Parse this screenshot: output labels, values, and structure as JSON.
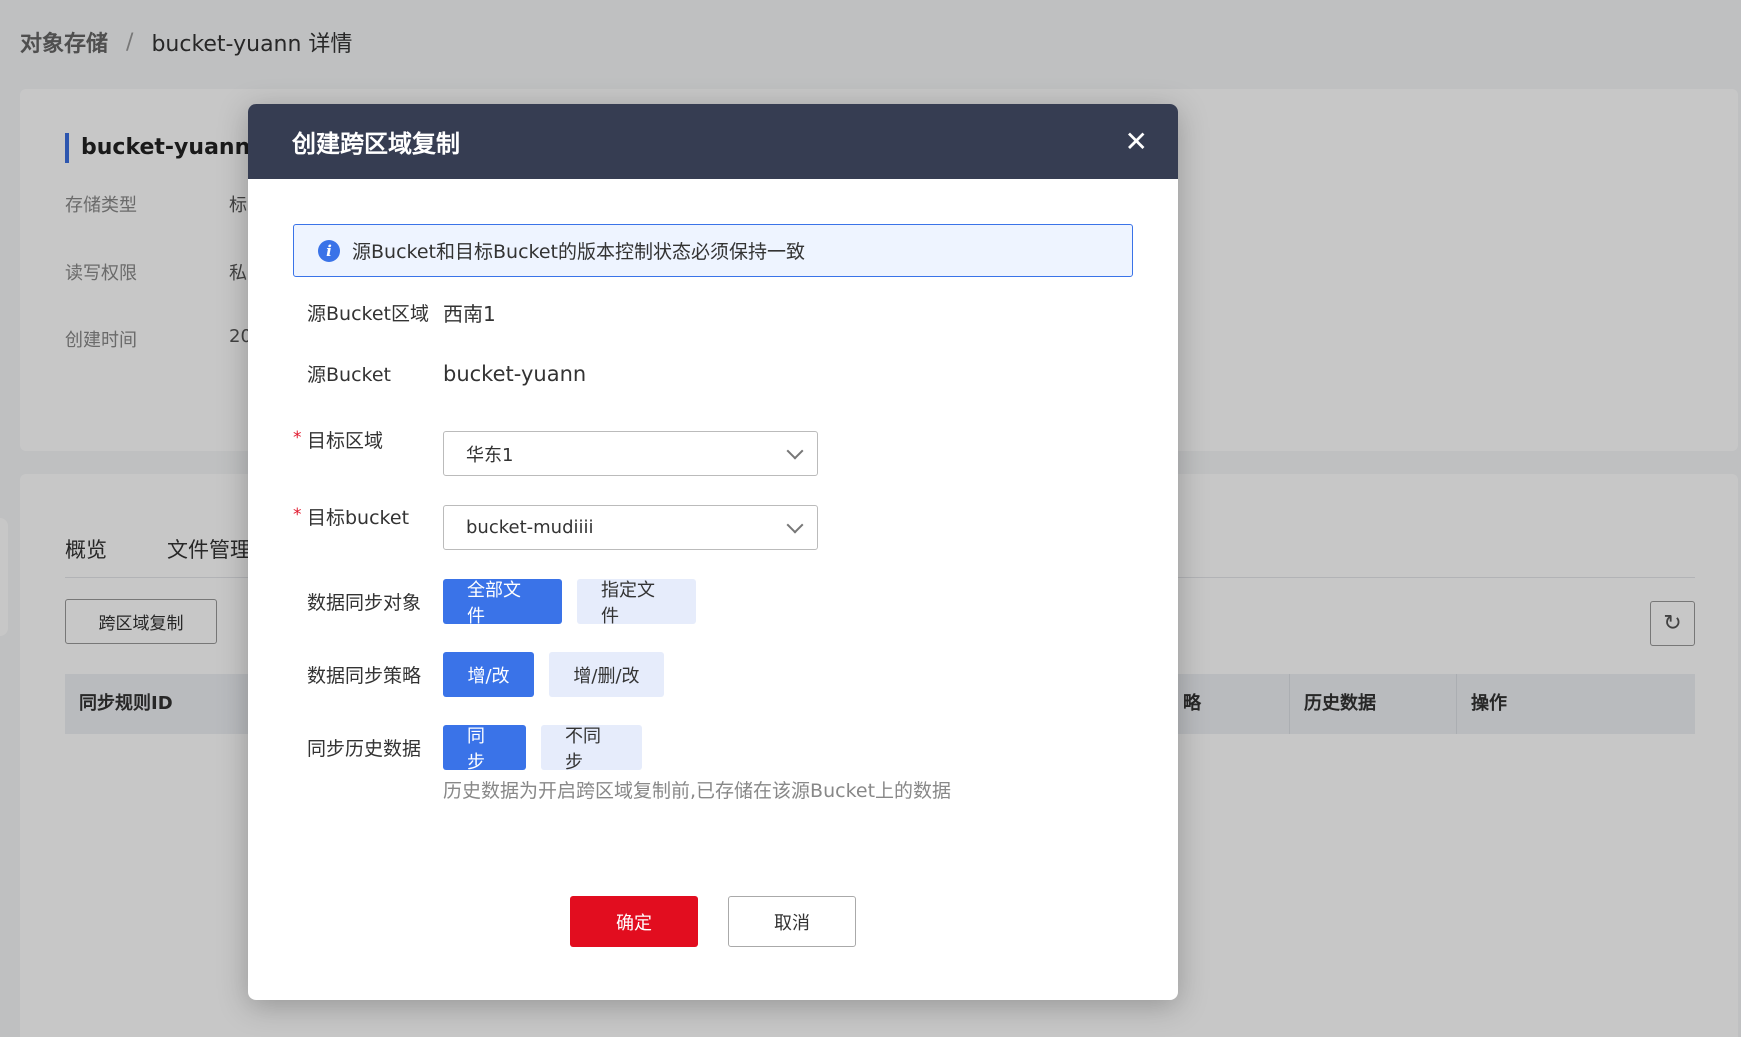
{
  "breadcrumb": {
    "root": "对象存储",
    "separator": "/",
    "current": "bucket-yuann 详情"
  },
  "info": {
    "title": "bucket-yuann详情",
    "rows": [
      {
        "label": "存储类型",
        "value": "标"
      },
      {
        "label": "读写权限",
        "value": "私"
      },
      {
        "label": "创建时间",
        "value": "20"
      }
    ]
  },
  "tabs": [
    "概览",
    "文件管理"
  ],
  "toolbar": {
    "cross_region_button": "跨区域复制",
    "refresh_icon": "refresh-icon"
  },
  "table": {
    "headers": [
      "同步规则ID",
      "略",
      "历史数据",
      "操作"
    ]
  },
  "modal": {
    "title": "创建跨区域复制",
    "close_icon": "close-icon",
    "alert": "源Bucket和目标Bucket的版本控制状态必须保持一致",
    "fields": {
      "source_region": {
        "label": "源Bucket区域",
        "value": "西南1"
      },
      "source_bucket": {
        "label": "源Bucket",
        "value": "bucket-yuann"
      },
      "target_region": {
        "label": "目标区域",
        "value": "华东1",
        "required": true
      },
      "target_bucket": {
        "label": "目标bucket",
        "value": "bucket-mudiiii",
        "required": true
      },
      "sync_object": {
        "label": "数据同步对象",
        "options": [
          "全部文件",
          "指定文件"
        ],
        "selected": "全部文件"
      },
      "sync_policy": {
        "label": "数据同步策略",
        "options": [
          "增/改",
          "增/删/改"
        ],
        "selected": "增/改"
      },
      "sync_history": {
        "label": "同步历史数据",
        "options": [
          "同步",
          "不同步"
        ],
        "selected": "同步"
      }
    },
    "hint": "历史数据为开启跨区域复制前,已存储在该源Bucket上的数据",
    "ok_label": "确定",
    "cancel_label": "取消",
    "colors": {
      "header_bg": "#363d52",
      "primary": "#3a73e8",
      "danger": "#e20d1f"
    }
  }
}
